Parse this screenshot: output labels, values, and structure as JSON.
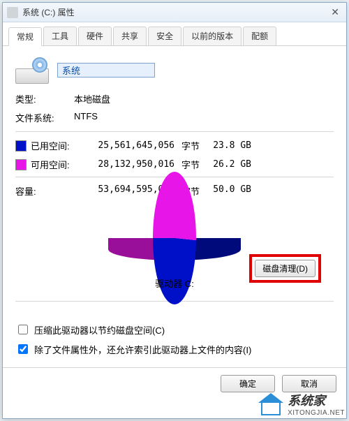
{
  "window": {
    "title": "系统 (C:) 属性"
  },
  "tabs": [
    "常规",
    "工具",
    "硬件",
    "共享",
    "安全",
    "以前的版本",
    "配额"
  ],
  "drive": {
    "name_value": "系统",
    "type_label": "类型:",
    "type_value": "本地磁盘",
    "fs_label": "文件系统:",
    "fs_value": "NTFS"
  },
  "space": {
    "used_label": "已用空间:",
    "used_bytes": "25,561,645,056",
    "used_unit": "字节",
    "used_gb": "23.8 GB",
    "free_label": "可用空间:",
    "free_bytes": "28,132,950,016",
    "free_unit": "字节",
    "free_gb": "26.2 GB",
    "capacity_label": "容量:",
    "capacity_bytes": "53,694,595,072",
    "capacity_unit": "字节",
    "capacity_gb": "50.0 GB"
  },
  "drive_letter_label": "驱动器 C:",
  "cleanup_button": "磁盘清理(D)",
  "checks": {
    "compress": "压缩此驱动器以节约磁盘空间(C)",
    "index": "除了文件属性外，还允许索引此驱动器上文件的内容(I)",
    "compress_checked": false,
    "index_checked": true
  },
  "footer": {
    "ok": "确定",
    "cancel": "取消"
  },
  "watermark": {
    "brand": "系统家",
    "url": "XITONGJIA.NET"
  },
  "colors": {
    "used": "#0010c8",
    "free": "#e815e8"
  },
  "chart_data": {
    "type": "pie",
    "title": "驱动器 C:",
    "series": [
      {
        "name": "已用空间",
        "value": 25561645056,
        "value_gb": 23.8,
        "color": "#0010c8"
      },
      {
        "name": "可用空间",
        "value": 28132950016,
        "value_gb": 26.2,
        "color": "#e815e8"
      }
    ],
    "total": 53694595072,
    "total_gb": 50.0
  }
}
